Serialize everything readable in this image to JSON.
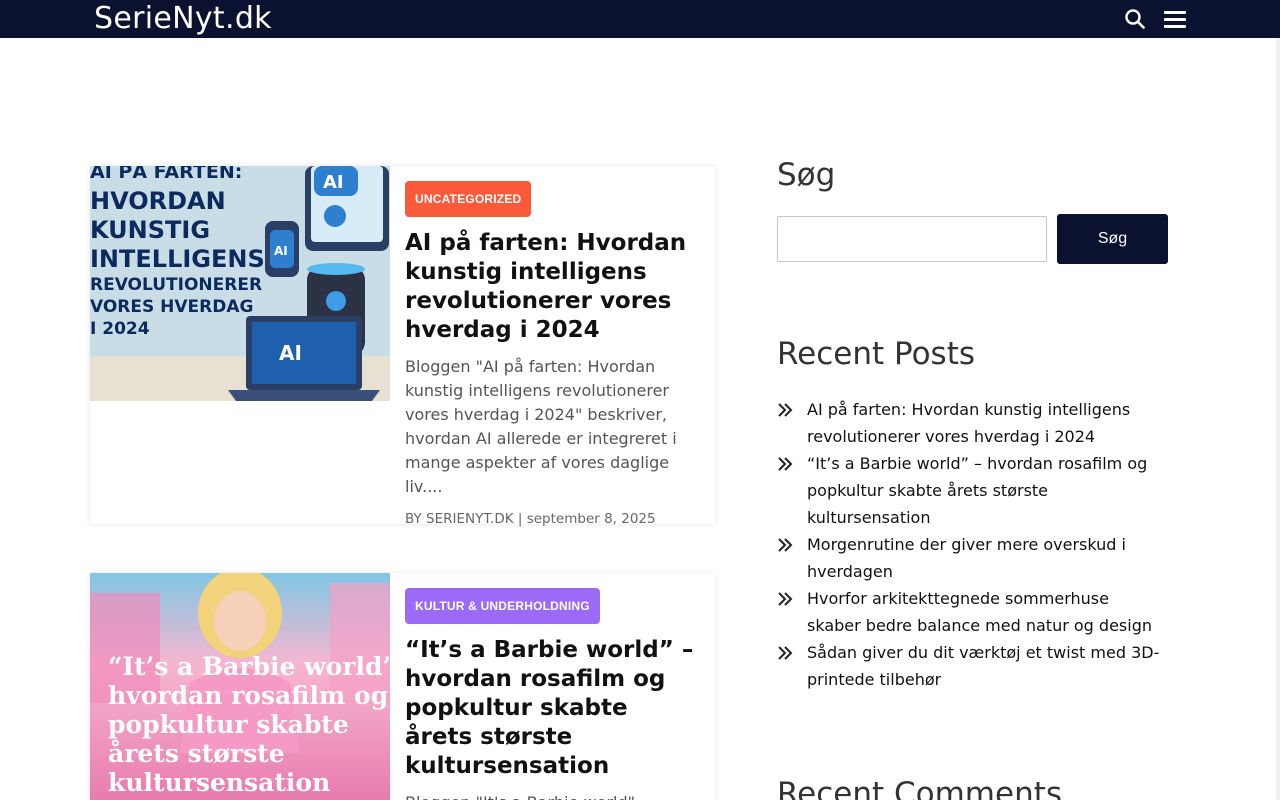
{
  "header": {
    "logo": "SerieNyt.dk",
    "search_icon": "search-icon",
    "menu_icon": "hamburger-menu-icon"
  },
  "posts": [
    {
      "category": "UNCATEGORIZED",
      "category_color": "#fb5a3a",
      "title": "AI på farten: Hvordan kunstig intelligens revolutionerer vores hverdag i 2024",
      "excerpt": "Bloggen \"AI på farten: Hvordan kunstig intelligens revolutionerer vores hverdag i 2024\" beskriver, hvordan AI allerede er integreret i mange aspekter af vores daglige liv....",
      "meta": "BY SERIENYT.DK | september 8, 2025",
      "image": {
        "line1": "AI PÅ FARTEN:",
        "line2": "HVORDAN",
        "line3": "KUNSTIG",
        "line4": "INTELLIGENS",
        "line5": "REVOLUTIONERER",
        "line6": "VORES HVERDAG",
        "line7": "I 2024",
        "badge": "AI"
      }
    },
    {
      "category": "KULTUR & UNDERHOLDNING",
      "category_color": "#9b6af6",
      "title": "“It’s a Barbie world” – hvordan rosafilm og popkultur skabte årets største kultursensation",
      "excerpt": "Bloggen \"It's a Barbie world\" analyserer den kulturelle betydning",
      "image": {
        "line1": "“It’s a Barbie world’ –",
        "line2": "hvordan rosafilm og",
        "line3": "popkultur skabte",
        "line4": "årets største",
        "line5": "kultursensation"
      }
    }
  ],
  "sidebar": {
    "search_heading": "Søg",
    "search_button": "Søg",
    "search_placeholder": "",
    "recent_heading": "Recent Posts",
    "recent_posts": [
      "AI på farten: Hvordan kunstig intelligens revolutionerer vores hverdag i 2024",
      "“It’s a Barbie world” – hvordan rosafilm og popkultur skabte årets største kultursensation",
      "Morgenrutine der giver mere overskud i hverdagen",
      "Hvorfor arkitekttegnede sommerhuse skaber bedre balance med natur og design",
      "Sådan giver du dit værktøj et twist med 3D-printede tilbehør"
    ],
    "comments_heading": "Recent Comments"
  },
  "colors": {
    "header_bg": "#0b1230",
    "button_bg": "#0b1230"
  }
}
